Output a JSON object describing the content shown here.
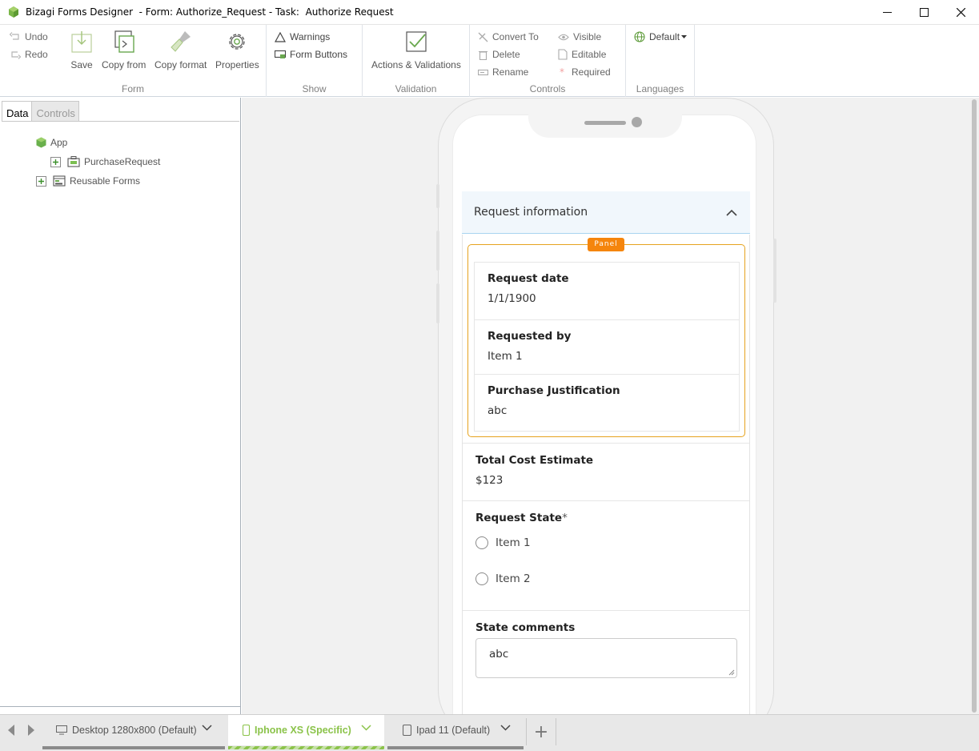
{
  "window": {
    "title": "Bizagi Forms Designer  - Form: Authorize_Request - Task:  Authorize Request",
    "minimize": "–",
    "maximize": "☐",
    "close": "✕"
  },
  "ribbon": {
    "undo": "Undo",
    "redo": "Redo",
    "save": "Save",
    "copy_from": "Copy from",
    "copy_format": "Copy format",
    "properties": "Properties",
    "group_form": "Form",
    "warnings": "Warnings",
    "form_buttons": "Form Buttons",
    "group_show": "Show",
    "actions_validations": "Actions & Validations",
    "group_validation": "Validation",
    "convert_to": "Convert To",
    "delete": "Delete",
    "rename": "Rename",
    "visible": "Visible",
    "editable": "Editable",
    "required": "Required",
    "group_controls": "Controls",
    "language": "Default",
    "group_languages": "Languages"
  },
  "left_panel": {
    "tabs": [
      "Data",
      "Controls"
    ],
    "tree": {
      "app": "App",
      "purchase_request": "PurchaseRequest",
      "reusable_forms": "Reusable Forms"
    }
  },
  "form": {
    "section_title": "Request information",
    "panel_badge": "Panel",
    "fields": {
      "request_date": {
        "label": "Request date",
        "value": "1/1/1900"
      },
      "requested_by": {
        "label": "Requested by",
        "value": "Item 1"
      },
      "purchase_justification": {
        "label": "Purchase Justification",
        "value": "abc"
      },
      "total_cost": {
        "label": "Total Cost Estimate",
        "value": "$123"
      },
      "request_state": {
        "label": "Request State",
        "required_mark": "*",
        "options": [
          "Item 1",
          "Item 2"
        ]
      },
      "state_comments": {
        "label": "State comments",
        "value": "abc"
      }
    }
  },
  "bottom_tabs": [
    {
      "label": "Desktop 1280x800 (Default)"
    },
    {
      "label": "Iphone XS (Specific)"
    },
    {
      "label": "Ipad 11 (Default)"
    }
  ],
  "add_tab": "+",
  "colors": {
    "accent_green": "#8bc34a",
    "panel_orange": "#f5850c",
    "section_border": "#a8d4f0"
  }
}
